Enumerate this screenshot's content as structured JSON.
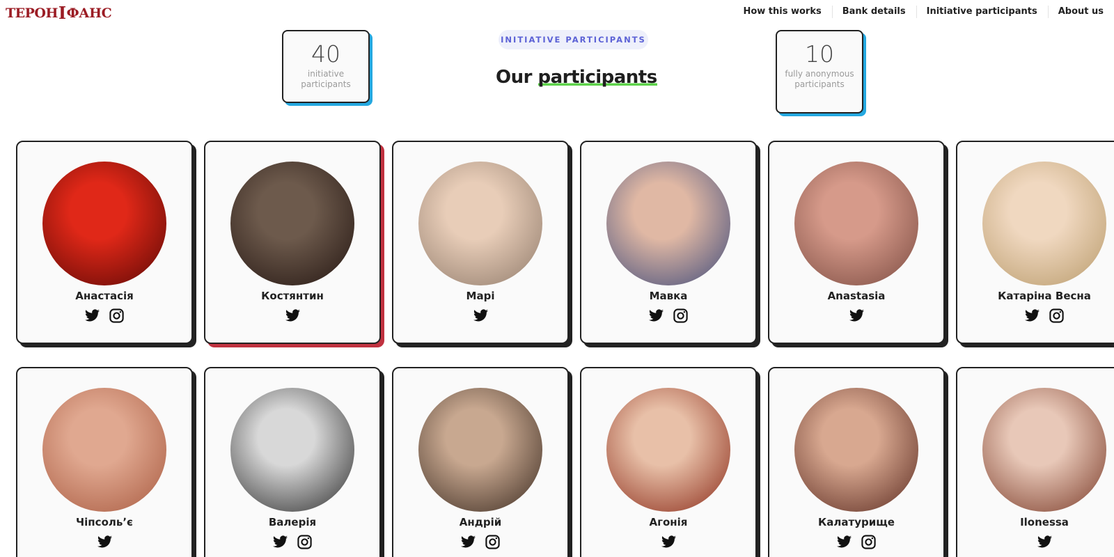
{
  "header": {
    "logo_text_left": "ТЕРОН",
    "logo_mark": "Ⅰ",
    "logo_text_right": "ФАНС",
    "nav": [
      "How this works",
      "Bank details",
      "Initiative participants",
      "About us"
    ]
  },
  "stats": [
    {
      "value": "40",
      "label": "initiative participants"
    },
    {
      "value": "10",
      "label": "fully anonymous participants"
    }
  ],
  "section": {
    "eyebrow": "INITIATIVE PARTICIPANTS",
    "title_prefix": "Our",
    "title_highlight": "participants"
  },
  "colors": {
    "card_shadow": "#222222",
    "accent_shadow": "#c0313f",
    "stat_shadow": "#24a8e0",
    "underline": "#5dd24a",
    "logo": "#9b1c24"
  },
  "participants": [
    {
      "name": "Анастасія",
      "links": [
        "twitter-icon",
        "instagram-icon"
      ],
      "photo_tone": [
        "#e02818",
        "#5a0805"
      ],
      "accent": false
    },
    {
      "name": "Костянтин",
      "links": [
        "twitter-icon"
      ],
      "photo_tone": [
        "#6d5a4c",
        "#231511"
      ],
      "accent": true
    },
    {
      "name": "Марі",
      "links": [
        "twitter-icon"
      ],
      "photo_tone": [
        "#e8cdb8",
        "#8f7a6a"
      ],
      "accent": false
    },
    {
      "name": "Мавка",
      "links": [
        "twitter-icon",
        "instagram-icon"
      ],
      "photo_tone": [
        "#e0b8a4",
        "#3e4a7a"
      ],
      "accent": false
    },
    {
      "name": "Anastasia",
      "links": [
        "twitter-icon"
      ],
      "photo_tone": [
        "#d69a8a",
        "#7a4a40"
      ],
      "accent": false
    },
    {
      "name": "Катаріна Весна",
      "links": [
        "twitter-icon",
        "instagram-icon"
      ],
      "photo_tone": [
        "#f0d8c0",
        "#b89a6a"
      ],
      "accent": false
    },
    {
      "name": "Чіпсольʼє",
      "links": [
        "twitter-icon"
      ],
      "photo_tone": [
        "#e0a890",
        "#a85a40"
      ],
      "accent": false
    },
    {
      "name": "Валерія",
      "links": [
        "twitter-icon",
        "instagram-icon"
      ],
      "photo_tone": [
        "#d8d8d8",
        "#2a2a2a"
      ],
      "accent": false
    },
    {
      "name": "Андрій",
      "links": [
        "twitter-icon",
        "instagram-icon"
      ],
      "photo_tone": [
        "#c8a890",
        "#3a2a20"
      ],
      "accent": false
    },
    {
      "name": "Агонія",
      "links": [
        "twitter-icon"
      ],
      "photo_tone": [
        "#e8c0a8",
        "#8a2a18"
      ],
      "accent": false
    },
    {
      "name": "Калатурище",
      "links": [
        "twitter-icon",
        "instagram-icon"
      ],
      "photo_tone": [
        "#d8a890",
        "#5a2a20"
      ],
      "accent": false
    },
    {
      "name": "Ilonessa",
      "links": [
        "twitter-icon"
      ],
      "photo_tone": [
        "#e8c8b8",
        "#7a3a28"
      ],
      "accent": false
    }
  ]
}
